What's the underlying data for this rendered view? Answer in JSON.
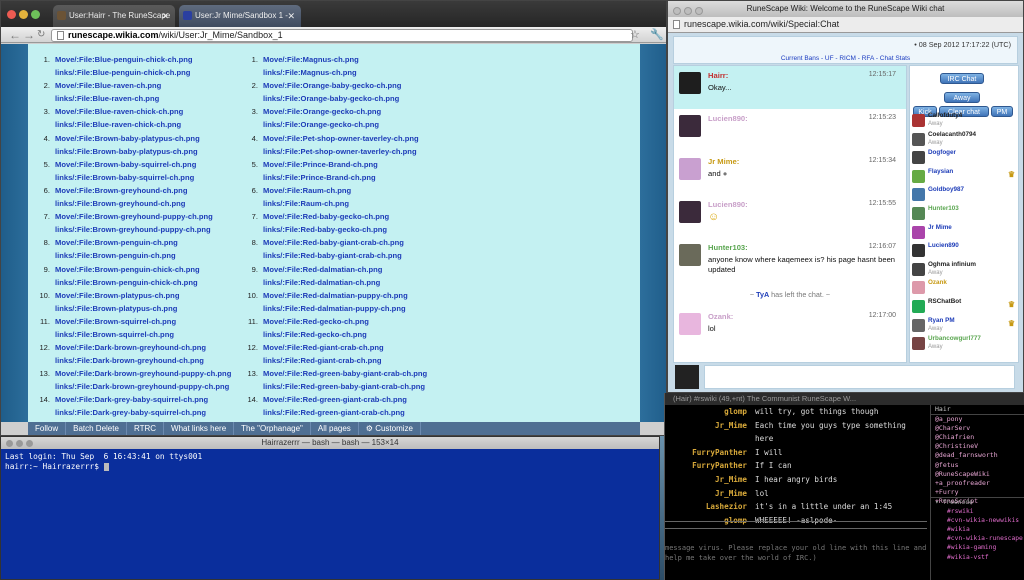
{
  "browser": {
    "tabs": [
      "User:Hairr - The RuneScape",
      "User:Jr Mime/Sandbox 1 -"
    ],
    "url_host": "runescape.wikia.com",
    "url_path": "/wiki/User:Jr_Mime/Sandbox_1",
    "list_left": [
      {
        "n": "1.",
        "a": "Move/:File:Blue-penguin-chick-ch.png",
        "b": "links/:File:Blue-penguin-chick-ch.png"
      },
      {
        "n": "2.",
        "a": "Move/:File:Blue-raven-ch.png",
        "b": "links/:File:Blue-raven-ch.png"
      },
      {
        "n": "3.",
        "a": "Move/:File:Blue-raven-chick-ch.png",
        "b": "links/:File:Blue-raven-chick-ch.png"
      },
      {
        "n": "4.",
        "a": "Move/:File:Brown-baby-platypus-ch.png",
        "b": "links/:File:Brown-baby-platypus-ch.png"
      },
      {
        "n": "5.",
        "a": "Move/:File:Brown-baby-squirrel-ch.png",
        "b": "links/:File:Brown-baby-squirrel-ch.png"
      },
      {
        "n": "6.",
        "a": "Move/:File:Brown-greyhound-ch.png",
        "b": "links/:File:Brown-greyhound-ch.png"
      },
      {
        "n": "7.",
        "a": "Move/:File:Brown-greyhound-puppy-ch.png",
        "b": "links/:File:Brown-greyhound-puppy-ch.png"
      },
      {
        "n": "8.",
        "a": "Move/:File:Brown-penguin-ch.png",
        "b": "links/:File:Brown-penguin-ch.png"
      },
      {
        "n": "9.",
        "a": "Move/:File:Brown-penguin-chick-ch.png",
        "b": "links/:File:Brown-penguin-chick-ch.png"
      },
      {
        "n": "10.",
        "a": "Move/:File:Brown-platypus-ch.png",
        "b": "links/:File:Brown-platypus-ch.png"
      },
      {
        "n": "11.",
        "a": "Move/:File:Brown-squirrel-ch.png",
        "b": "links/:File:Brown-squirrel-ch.png"
      },
      {
        "n": "12.",
        "a": "Move/:File:Dark-brown-greyhound-ch.png",
        "b": "links/:File:Dark-brown-greyhound-ch.png"
      },
      {
        "n": "13.",
        "a": "Move/:File:Dark-brown-greyhound-puppy-ch.png",
        "b": "links/:File:Dark-brown-greyhound-puppy-ch.png"
      },
      {
        "n": "14.",
        "a": "Move/:File:Dark-grey-baby-squirrel-ch.png",
        "b": "links/:File:Dark-grey-baby-squirrel-ch.png"
      }
    ],
    "list_right": [
      {
        "n": "1.",
        "a": "Move/:File:Magnus-ch.png",
        "b": "links/:File:Magnus-ch.png"
      },
      {
        "n": "2.",
        "a": "Move/:File:Orange-baby-gecko-ch.png",
        "b": "links/:File:Orange-baby-gecko-ch.png"
      },
      {
        "n": "3.",
        "a": "Move/:File:Orange-gecko-ch.png",
        "b": "links/:File:Orange-gecko-ch.png"
      },
      {
        "n": "4.",
        "a": "Move/:File:Pet-shop-owner-taverley-ch.png",
        "b": "links/:File:Pet-shop-owner-taverley-ch.png"
      },
      {
        "n": "5.",
        "a": "Move/:File:Prince-Brand-ch.png",
        "b": "links/:File:Prince-Brand-ch.png"
      },
      {
        "n": "6.",
        "a": "Move/:File:Raum-ch.png",
        "b": "links/:File:Raum-ch.png"
      },
      {
        "n": "7.",
        "a": "Move/:File:Red-baby-gecko-ch.png",
        "b": "links/:File:Red-baby-gecko-ch.png"
      },
      {
        "n": "8.",
        "a": "Move/:File:Red-baby-giant-crab-ch.png",
        "b": "links/:File:Red-baby-giant-crab-ch.png"
      },
      {
        "n": "9.",
        "a": "Move/:File:Red-dalmatian-ch.png",
        "b": "links/:File:Red-dalmatian-ch.png"
      },
      {
        "n": "10.",
        "a": "Move/:File:Red-dalmatian-puppy-ch.png",
        "b": "links/:File:Red-dalmatian-puppy-ch.png"
      },
      {
        "n": "11.",
        "a": "Move/:File:Red-gecko-ch.png",
        "b": "links/:File:Red-gecko-ch.png"
      },
      {
        "n": "12.",
        "a": "Move/:File:Red-giant-crab-ch.png",
        "b": "links/:File:Red-giant-crab-ch.png"
      },
      {
        "n": "13.",
        "a": "Move/:File:Red-green-baby-giant-crab-ch.png",
        "b": "links/:File:Red-green-baby-giant-crab-ch.png"
      },
      {
        "n": "14.",
        "a": "Move/:File:Red-green-giant-crab-ch.png",
        "b": "links/:File:Red-green-giant-crab-ch.png"
      }
    ],
    "toolbar": [
      "Follow",
      "Batch Delete",
      "RTRC",
      "What links here",
      "The \"Orphanage\"",
      "All pages",
      "Customize"
    ]
  },
  "terminal": {
    "title": "Hairrazerrr — bash — bash — 153×14",
    "lines": [
      "Last login: Thu Sep  6 16:43:41 on ttys001",
      "hairr:~ Hairrazerrr$ "
    ]
  },
  "chat": {
    "window_title": "RuneScape Wiki: Welcome to the RuneScape Wiki chat",
    "url_host": "runescape.wikia.com",
    "url_path": "/wiki/Special:Chat",
    "timestamp": "• 08 Sep 2012 17:17:22 (UTC)",
    "header_links": "Current Bans - UF - RICM - RFA - Chat Stats",
    "messages": [
      {
        "who": "Hairr:",
        "time": "12:15:17",
        "text": "Okay...",
        "color": "#c22e2e",
        "hl": true
      },
      {
        "who": "Lucien890:",
        "time": "12:15:23",
        "text": "",
        "color": "#c9a0c9",
        "hl": false
      },
      {
        "who": "Jr Mime:",
        "time": "12:15:34",
        "text": "and",
        "color": "#c79a14",
        "hl": false
      },
      {
        "who": "Lucien890:",
        "time": "12:15:55",
        "text": "",
        "color": "#c9a0c9",
        "hl": false
      },
      {
        "who": "Hunter103:",
        "time": "12:16:07",
        "text": "anyone know where kaqemeex is? his page hasnt been updated",
        "color": "#5aa650",
        "hl": false
      }
    ],
    "left_notice": {
      "prefix": "~ ",
      "user": "TyA",
      "suffix": " has left the chat. ~"
    },
    "last_message": {
      "who": "Ozank:",
      "time": "12:17:00",
      "text": "lol",
      "color": "#c9a0c9"
    },
    "buttons": {
      "irc": "IRC Chat",
      "away": "Away",
      "kick": "Kick",
      "clear": "Clear chat",
      "pm": "PM"
    },
    "users": [
      {
        "name": "Callofduty4",
        "away": "Away",
        "color": "#222"
      },
      {
        "name": "Coelacanth0794",
        "away": "Away",
        "color": "#222"
      },
      {
        "name": "Dogfoger",
        "away": "",
        "color": "#1d3cb8"
      },
      {
        "name": "Flaysian",
        "away": "",
        "color": "#1d3cb8",
        "badge": "♛"
      },
      {
        "name": "Goldboy987",
        "away": "",
        "color": "#1d3cb8"
      },
      {
        "name": "Hunter103",
        "away": "",
        "color": "#5aa650"
      },
      {
        "name": "Jr Mime",
        "away": "",
        "color": "#1d3cb8"
      },
      {
        "name": "Lucien890",
        "away": "",
        "color": "#1d3cb8"
      },
      {
        "name": "Oghma infinium",
        "away": "Away",
        "color": "#222"
      },
      {
        "name": "Ozank",
        "away": "",
        "color": "#c79a14"
      },
      {
        "name": "RSChatBot",
        "away": "",
        "color": "#222",
        "badge": "♛"
      },
      {
        "name": "Ryan PM",
        "away": "Away",
        "color": "#1d3cb8",
        "badge": "♛"
      },
      {
        "name": "Urbancowgurl777",
        "away": "Away",
        "color": "#5aa650"
      }
    ]
  },
  "irc": {
    "title": "(Hair) #rswiki (49,+nt) The Communist RuneScape W...",
    "messages": [
      {
        "n": "glomp",
        "t": "will try, got things though"
      },
      {
        "n": "Jr_Mime",
        "t": "Each time you guys type something here"
      },
      {
        "n": "FurryPanther",
        "t": "I will"
      },
      {
        "n": "FurryPanther",
        "t": "If I can"
      },
      {
        "n": "Jr_Mime",
        "t": "I hear angry birds"
      },
      {
        "n": "Jr_Mime",
        "t": "lol"
      },
      {
        "n": "Lashezior",
        "t": "it's in a little under an 1:45"
      },
      {
        "n": "glomp",
        "t": "WHEEEEE! -aslpode-"
      }
    ],
    "bottom_text": "message virus. Please replace your old line with this line and help me take over the world of IRC.)",
    "channel_users": [
      "Hair",
      "@a_pony",
      "@CharServ",
      "@Chiafrien",
      "@ChristineV",
      "@dead_farnsworth",
      "@fetus",
      "@RuneScapeWiki",
      "+a_proofreader",
      "+Furry",
      "+RuneScript"
    ],
    "network": "freenode",
    "channels": [
      "#rswiki",
      "#cvn-wikia-newwikis",
      "#wikia",
      "#cvn-wikia-runescape",
      "#wikia-gaming",
      "#wikia-vstf"
    ]
  }
}
